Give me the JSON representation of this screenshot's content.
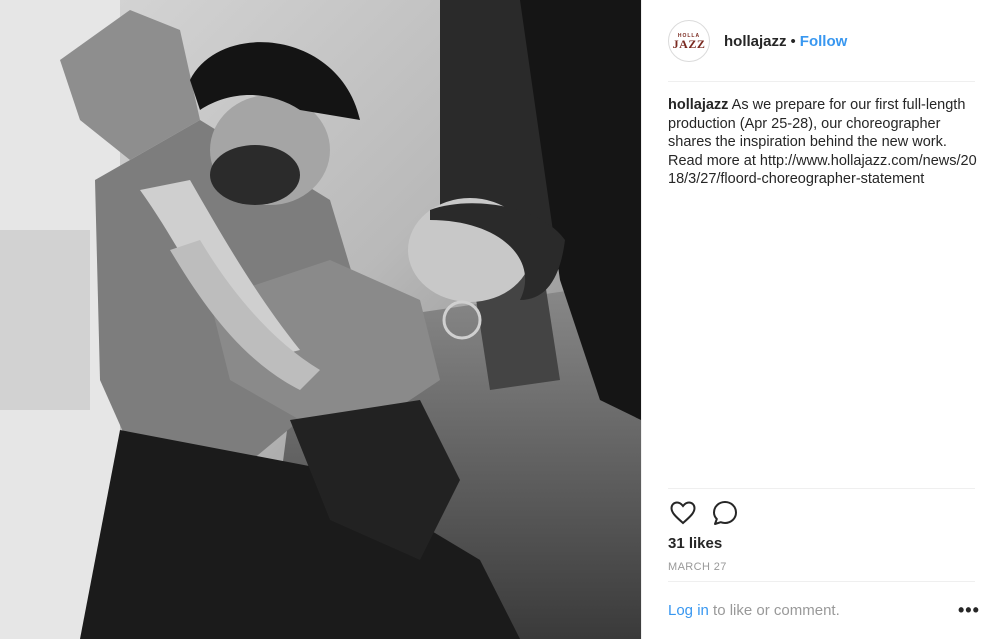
{
  "post": {
    "username": "hollajazz",
    "separator": "•",
    "follow_label": "Follow",
    "avatar_text_top": "HOLLA",
    "avatar_text_bottom": "JAZZ",
    "photo_icon": "dancers-photo",
    "caption_user": "hollajazz",
    "caption_text": "As we prepare for our first full-length production (Apr 25-28), our choreographer shares the inspiration behind the new work. Read more at",
    "caption_link": "http://www.hollajazz.com/news/2018/3/27/floord-choreographer-statement",
    "likes": "31 likes",
    "date": "MARCH 27",
    "login_label": "Log in",
    "login_suffix": "to like or comment.",
    "more_label": "•••"
  },
  "icons": {
    "like": "heart-icon",
    "comment": "comment-icon",
    "more": "more-options-icon"
  },
  "colors": {
    "accent": "#3897f0",
    "text": "#262626",
    "muted": "#999999",
    "divider": "#efefef"
  }
}
